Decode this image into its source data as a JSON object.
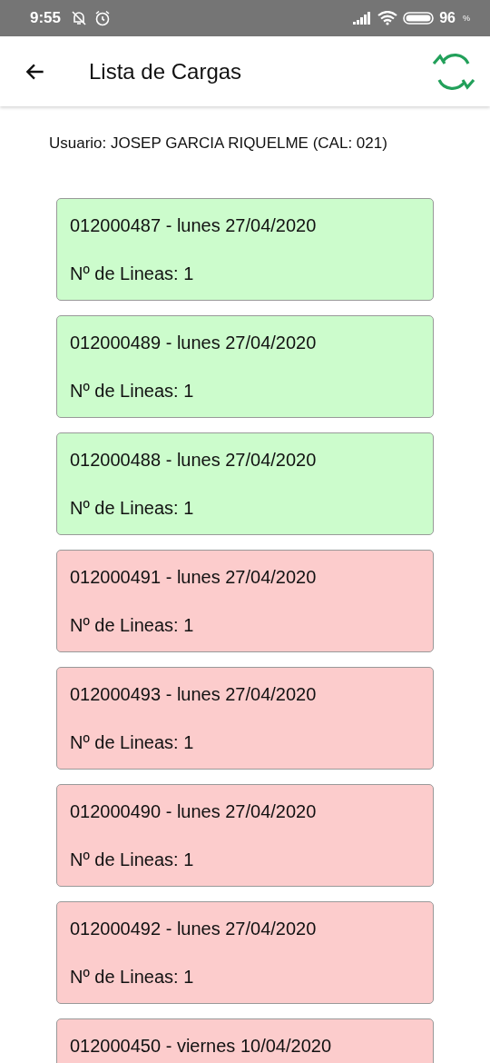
{
  "status_bar": {
    "time": "9:55",
    "battery": "96",
    "battery_unit": "%"
  },
  "app_bar": {
    "title": "Lista de Cargas"
  },
  "user": "Usuario: JOSEP GARCIA RIQUELME (CAL: 021)",
  "loads": [
    {
      "title": "012000487 - lunes 27/04/2020",
      "lines": "Nº de Lineas: 1",
      "done": true
    },
    {
      "title": "012000489 - lunes 27/04/2020",
      "lines": "Nº de Lineas: 1",
      "done": true
    },
    {
      "title": "012000488 - lunes 27/04/2020",
      "lines": "Nº de Lineas: 1",
      "done": true
    },
    {
      "title": "012000491 - lunes 27/04/2020",
      "lines": "Nº de Lineas: 1",
      "done": false
    },
    {
      "title": "012000493 - lunes 27/04/2020",
      "lines": "Nº de Lineas: 1",
      "done": false
    },
    {
      "title": "012000490 - lunes 27/04/2020",
      "lines": "Nº de Lineas: 1",
      "done": false
    },
    {
      "title": "012000492 - lunes 27/04/2020",
      "lines": "Nº de Lineas: 1",
      "done": false
    },
    {
      "title": "012000450 - viernes 10/04/2020",
      "done": false
    }
  ]
}
